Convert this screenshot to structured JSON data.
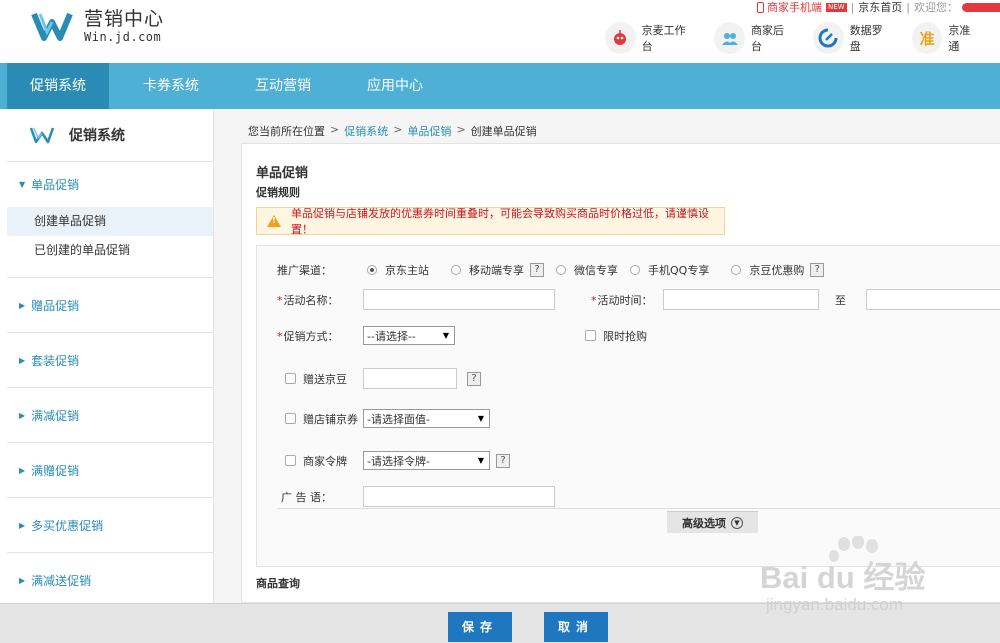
{
  "logo": {
    "title": "营销中心",
    "subtitle": "Win.jd.com"
  },
  "toplinks": {
    "phone": "商家手机端",
    "new_badge": "NEW",
    "home": "京东首页",
    "welcome": "欢迎您："
  },
  "quick_apps": [
    {
      "label": "京麦工作台",
      "icon": "robot-icon"
    },
    {
      "label": "商家后台",
      "icon": "users-icon"
    },
    {
      "label": "数据罗盘",
      "icon": "compass-icon"
    },
    {
      "label": "京准通",
      "icon": "jzt-icon"
    }
  ],
  "nav": [
    "促销系统",
    "卡券系统",
    "互动营销",
    "应用中心"
  ],
  "sidebar": {
    "title": "促销系统",
    "groups": [
      {
        "label": "单品促销",
        "subs": [
          "创建单品促销",
          "已创建的单品促销"
        ]
      },
      {
        "label": "赠品促销"
      },
      {
        "label": "套装促销"
      },
      {
        "label": "满减促销"
      },
      {
        "label": "满赠促销"
      },
      {
        "label": "多买优惠促销"
      },
      {
        "label": "满减送促销"
      }
    ]
  },
  "breadcrumb": {
    "prefix": "您当前所在位置",
    "items": [
      "促销系统",
      "单品促销",
      "创建单品促销"
    ]
  },
  "panel": {
    "title": "单品促销",
    "subtitle": "促销规则",
    "warning": "单品促销与店铺发放的优惠券时间重叠时，可能会导致购买商品时价格过低，请谨慎设置！"
  },
  "form": {
    "channel_label": "推广渠道：",
    "channels": [
      "京东主站",
      "移动端专享",
      "微信专享",
      "手机QQ专享",
      "京豆优惠购"
    ],
    "name_label": "活动名称：",
    "time_label": "活动时间：",
    "time_to": "至",
    "method_label": "促销方式：",
    "method_select": "--请选择--",
    "flash_label": "限时抢购",
    "jingdou_label": "赠送京豆",
    "coupon_label": "赠店铺京券",
    "coupon_select": "-请选择面值-",
    "token_label": "商家令牌",
    "token_select": "-请选择令牌-",
    "ad_label": "广 告 语：",
    "advanced": "高级选项",
    "question": "?"
  },
  "goods_title": "商品查询",
  "footer": {
    "save": "保存",
    "cancel": "取消"
  },
  "watermark": {
    "brand": "Bai du 经验",
    "url": "jingyan.baidu.com"
  },
  "colors": {
    "nav": "#4fb0d6",
    "nav_active": "#2a8cb5",
    "accent_red": "#c81623",
    "button": "#1f78bf"
  }
}
